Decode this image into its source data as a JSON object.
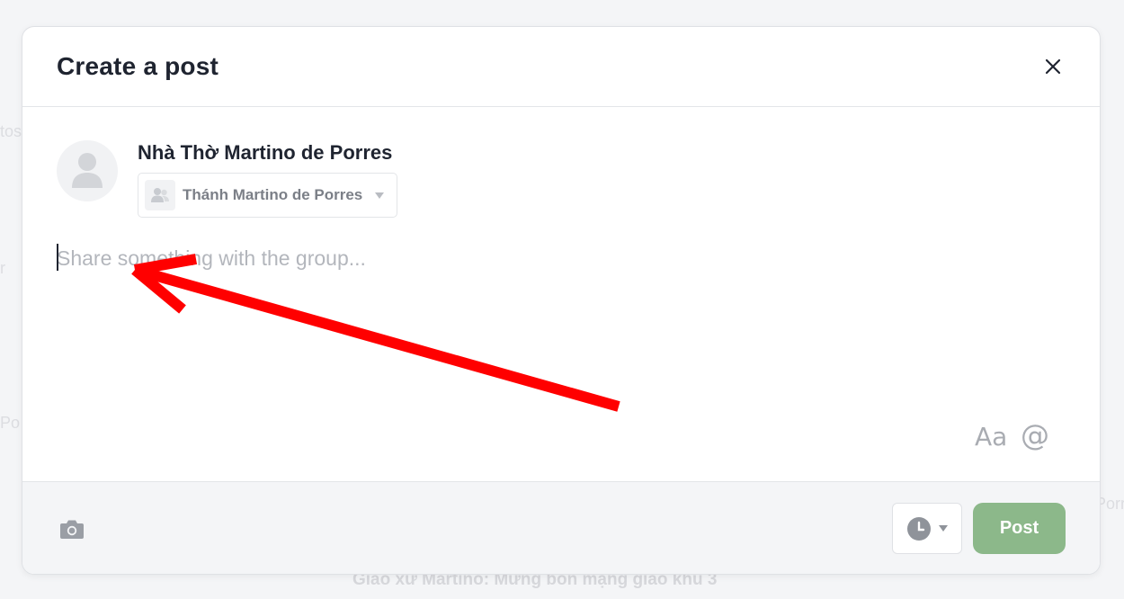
{
  "background": {
    "photos_fragment": "tos",
    "r_fragment": "r",
    "po_fragment": "Po",
    "porr_fragment": "Porr",
    "headline": "Giáo xứ Martino: Mừng bổn mạng giáo khu 3"
  },
  "modal": {
    "title": "Create a post",
    "author_name": "Nhà Thờ Martino de Porres",
    "audience_label": "Thánh Martino de Porres",
    "input_placeholder": "Share something with the group...",
    "input_value": "",
    "format_label": "Aa",
    "mention_label": "@",
    "post_label": "Post"
  },
  "colors": {
    "post_button": "#8cb88a",
    "annotation_arrow": "#ff0000"
  },
  "icons": {
    "close": "close-icon",
    "avatar": "user-icon",
    "audience": "group-icon",
    "camera": "camera-icon",
    "schedule": "clock-icon"
  }
}
